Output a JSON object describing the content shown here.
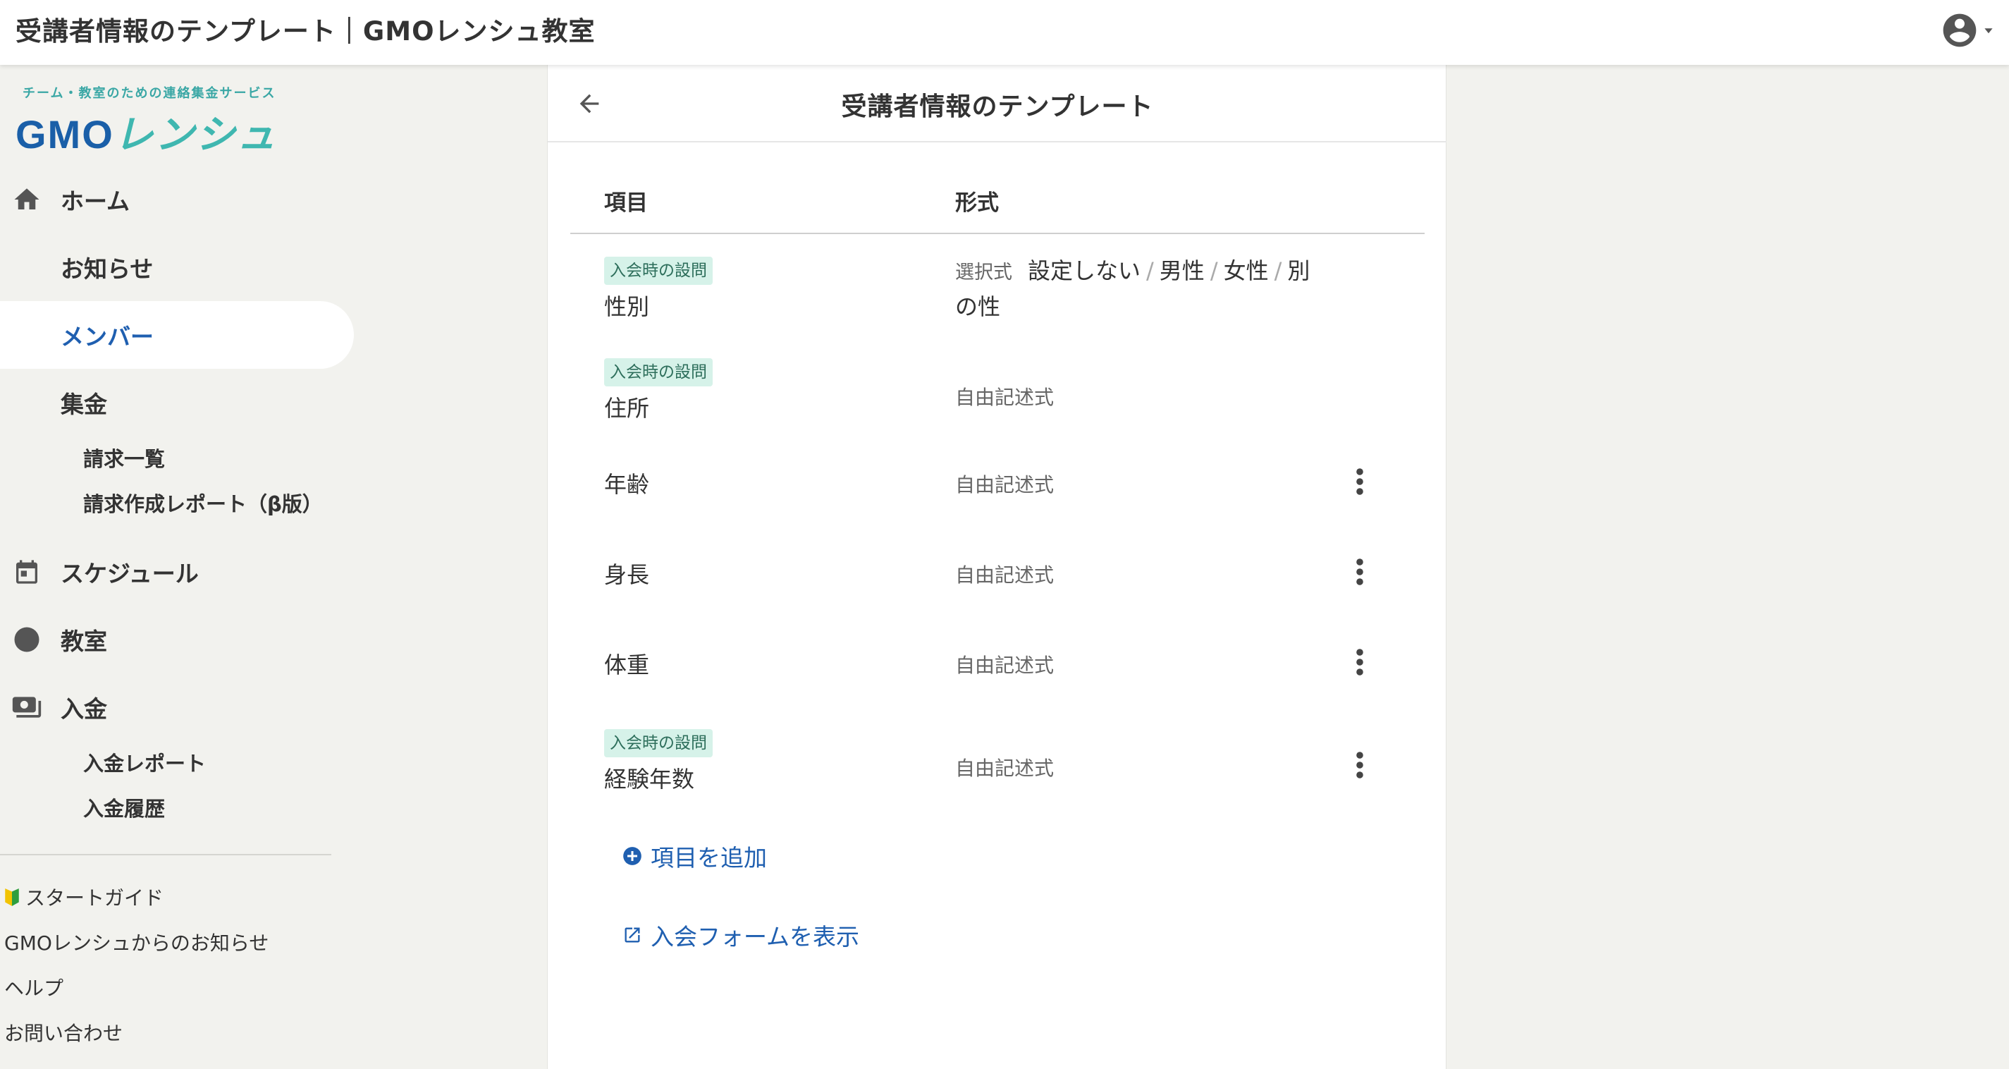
{
  "topbar": {
    "title": "受講者情報のテンプレート｜GMOレンシュ教室",
    "account_icon": "account-circle-icon"
  },
  "logo": {
    "tagline": "チーム・教室のための連絡集金サービス",
    "brand_latin": "GMO",
    "brand_kana": "レンシュ"
  },
  "sidebar": {
    "items": [
      {
        "label": "ホーム",
        "icon": "home-icon"
      },
      {
        "label": "お知らせ",
        "icon": ""
      },
      {
        "label": "メンバー",
        "icon": "",
        "active": true
      },
      {
        "label": "集金",
        "icon": ""
      },
      {
        "label": "スケジュール",
        "icon": "calendar-icon"
      },
      {
        "label": "教室",
        "icon": "circle-icon"
      },
      {
        "label": "入金",
        "icon": "money-icon"
      }
    ],
    "billing_sub": [
      "請求一覧",
      "請求作成レポート（β版）"
    ],
    "deposit_sub": [
      "入金レポート",
      "入金履歴"
    ],
    "footer_links": [
      "スタートガイド",
      "GMOレンシュからのお知らせ",
      "ヘルプ",
      "お問い合わせ"
    ]
  },
  "panel": {
    "title": "受講者情報のテンプレート",
    "col_item": "項目",
    "col_format": "形式",
    "badge_text": "入会時の設問",
    "rows": [
      {
        "label": "性別",
        "badge": true,
        "format_kind": "選択式",
        "choices": [
          "設定しない",
          "男性",
          "女性",
          "別の性"
        ],
        "menu": false
      },
      {
        "label": "住所",
        "badge": true,
        "format": "自由記述式",
        "menu": false
      },
      {
        "label": "年齢",
        "badge": false,
        "format": "自由記述式",
        "menu": true
      },
      {
        "label": "身長",
        "badge": false,
        "format": "自由記述式",
        "menu": true
      },
      {
        "label": "体重",
        "badge": false,
        "format": "自由記述式",
        "menu": true
      },
      {
        "label": "経験年数",
        "badge": true,
        "format": "自由記述式",
        "menu": true
      }
    ],
    "add_item": "項目を追加",
    "show_form": "入会フォームを表示"
  },
  "colors": {
    "accent": "#1f5fb0",
    "badge_bg": "#d6f2e9",
    "badge_text": "#2d6e5b",
    "sidebar_bg": "#f2f2ee"
  }
}
